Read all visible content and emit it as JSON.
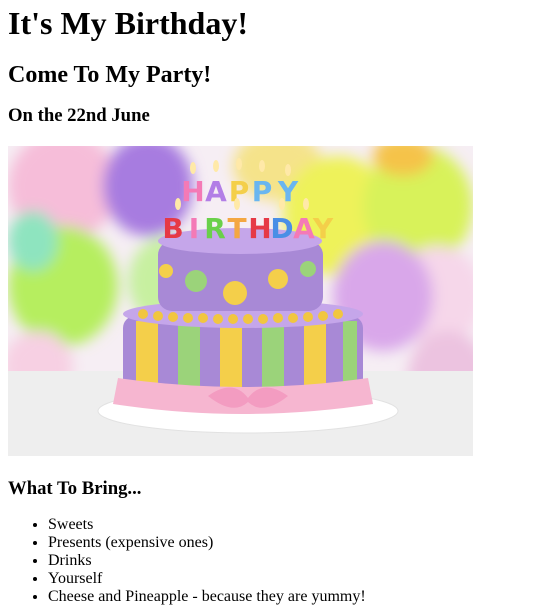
{
  "page": {
    "title": "It's My Birthday!",
    "subtitle": "Come To My Party!",
    "date": "On the 22nd June",
    "bring_heading": "What To Bring...",
    "bring_items": [
      "Sweets",
      "Presents (expensive ones)",
      "Drinks",
      "Yourself",
      "Cheese and Pineapple - because they are yummy!"
    ]
  },
  "image": {
    "cake_letters_top": [
      "H",
      "A",
      "P",
      "P",
      "Y"
    ],
    "cake_letters_bottom": [
      "B",
      "I",
      "R",
      "T",
      "H",
      "D",
      "A",
      "Y"
    ],
    "colors": {
      "balloon_purple": "#a77be0",
      "balloon_yellow": "#eef25a",
      "balloon_green": "#b6ee5e",
      "balloon_pink": "#f3a9d2",
      "cake_purple": "#a889d6",
      "cake_yellow": "#f4cf4a",
      "cake_green": "#9bd37a",
      "ribbon_pink": "#f6b6d0"
    }
  }
}
